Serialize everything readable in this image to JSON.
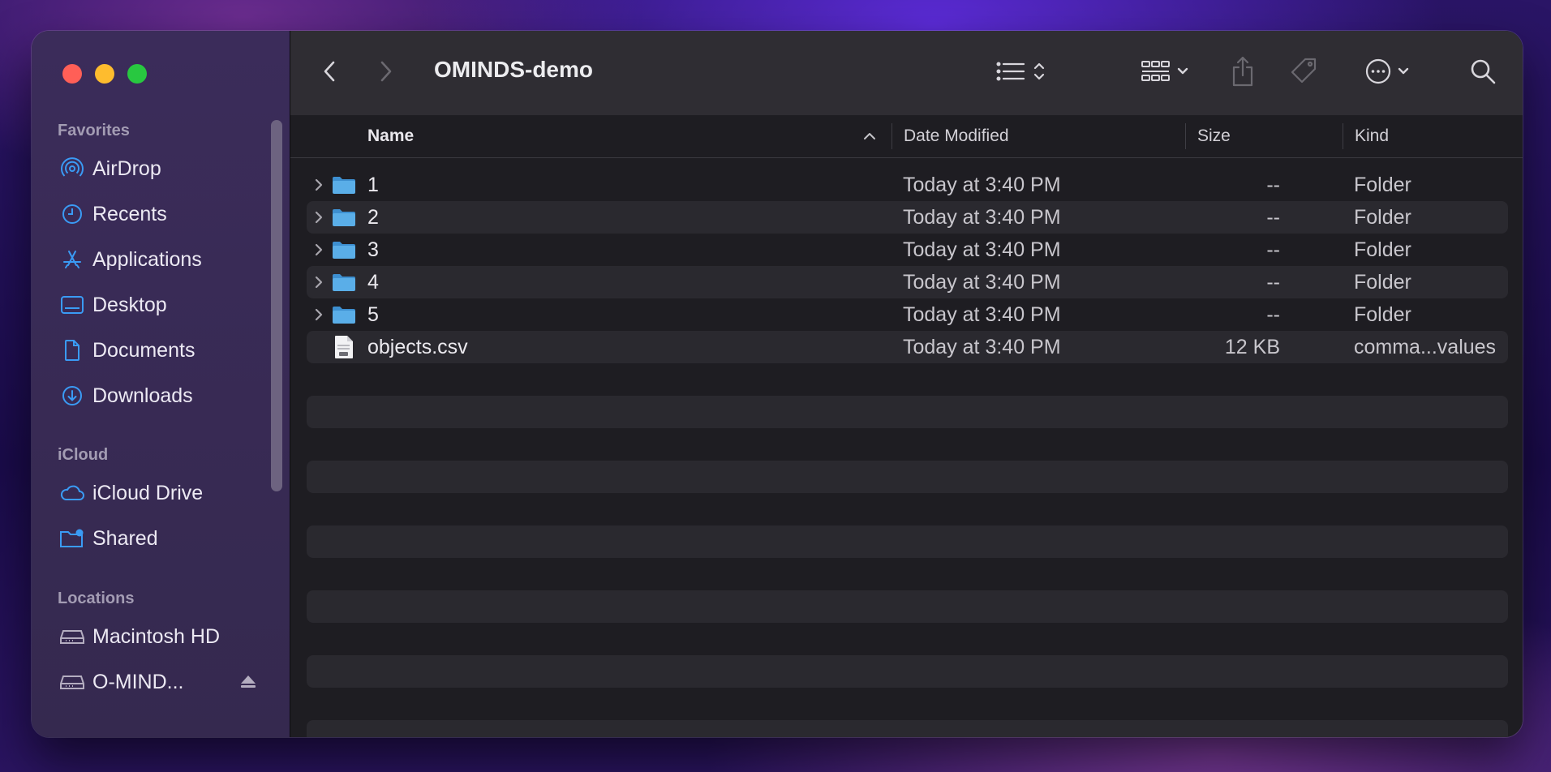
{
  "sidebar": {
    "sections": {
      "favorites": "Favorites",
      "icloud": "iCloud",
      "locations": "Locations"
    },
    "favorites": [
      {
        "label": "AirDrop",
        "icon": "airdrop-icon"
      },
      {
        "label": "Recents",
        "icon": "clock-icon"
      },
      {
        "label": "Applications",
        "icon": "applications-icon"
      },
      {
        "label": "Desktop",
        "icon": "desktop-icon"
      },
      {
        "label": "Documents",
        "icon": "document-icon"
      },
      {
        "label": "Downloads",
        "icon": "download-icon"
      }
    ],
    "icloud": [
      {
        "label": "iCloud Drive",
        "icon": "cloud-icon"
      },
      {
        "label": "Shared",
        "icon": "shared-folder-icon"
      }
    ],
    "locations": [
      {
        "label": "Macintosh HD",
        "icon": "hard-drive-icon"
      },
      {
        "label": "O-MIND...",
        "icon": "hard-drive-icon",
        "ejectable": true
      }
    ]
  },
  "toolbar": {
    "title": "OMINDS-demo",
    "icons": [
      "back-icon",
      "forward-icon",
      "list-view-icon",
      "group-icon",
      "share-icon",
      "tag-icon",
      "more-icon",
      "search-icon"
    ]
  },
  "columns": {
    "name": "Name",
    "date": "Date Modified",
    "size": "Size",
    "kind": "Kind"
  },
  "files": [
    {
      "name": "1",
      "date": "Today at 3:40 PM",
      "size": "--",
      "kind": "Folder",
      "type": "folder"
    },
    {
      "name": "2",
      "date": "Today at 3:40 PM",
      "size": "--",
      "kind": "Folder",
      "type": "folder"
    },
    {
      "name": "3",
      "date": "Today at 3:40 PM",
      "size": "--",
      "kind": "Folder",
      "type": "folder"
    },
    {
      "name": "4",
      "date": "Today at 3:40 PM",
      "size": "--",
      "kind": "Folder",
      "type": "folder"
    },
    {
      "name": "5",
      "date": "Today at 3:40 PM",
      "size": "--",
      "kind": "Folder",
      "type": "folder"
    },
    {
      "name": "objects.csv",
      "date": "Today at 3:40 PM",
      "size": "12 KB",
      "kind": "comma...values",
      "type": "csv"
    }
  ],
  "colors": {
    "accent": "#3a9bf5",
    "folder": "#5aaee8"
  }
}
